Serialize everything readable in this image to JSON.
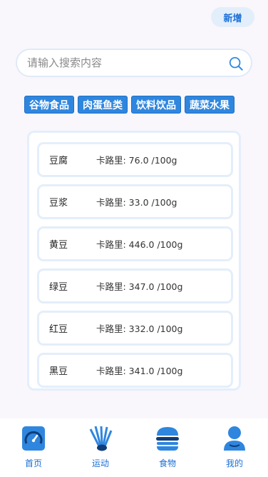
{
  "header": {
    "add_label": "新增"
  },
  "search": {
    "placeholder": "请输入搜索内容"
  },
  "categories": [
    "谷物食品",
    "肉蛋鱼类",
    "饮料饮品",
    "蔬菜水果"
  ],
  "foods": [
    {
      "name": "豆腐",
      "calorie": "卡路里: 76.0 /100g"
    },
    {
      "name": "豆浆",
      "calorie": "卡路里: 33.0 /100g"
    },
    {
      "name": "黄豆",
      "calorie": "卡路里: 446.0 /100g"
    },
    {
      "name": "绿豆",
      "calorie": "卡路里: 347.0 /100g"
    },
    {
      "name": "红豆",
      "calorie": "卡路里: 332.0 /100g"
    },
    {
      "name": "黑豆",
      "calorie": "卡路里: 341.0 /100g"
    }
  ],
  "tabs": [
    {
      "label": "首页",
      "icon": "speedometer-icon"
    },
    {
      "label": "运动",
      "icon": "shuttlecock-icon"
    },
    {
      "label": "食物",
      "icon": "burger-icon"
    },
    {
      "label": "我的",
      "icon": "user-icon"
    }
  ],
  "colors": {
    "accent": "#2f86de",
    "text_accent": "#1b6fd6",
    "border": "#e4eefb"
  }
}
